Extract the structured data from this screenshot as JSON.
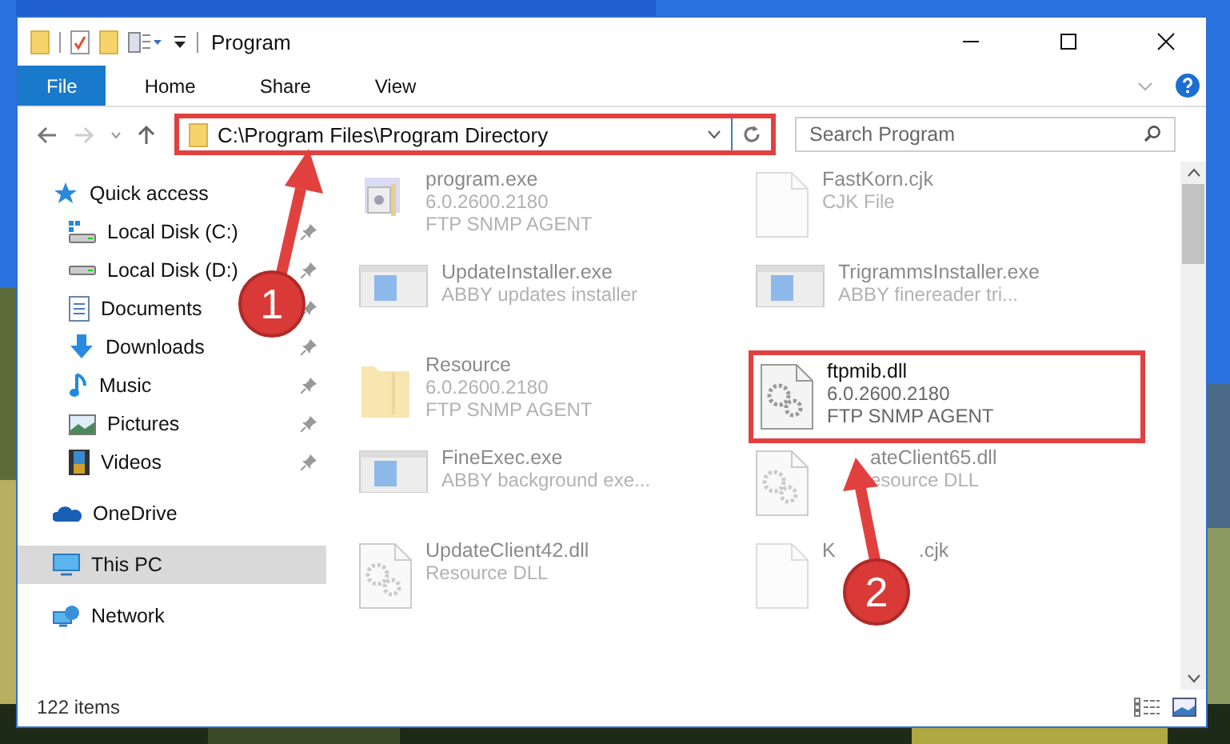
{
  "window": {
    "title": "Program"
  },
  "ribbon_tabs": [
    {
      "label": "File",
      "selected": true
    },
    {
      "label": "Home",
      "selected": false
    },
    {
      "label": "Share",
      "selected": false
    },
    {
      "label": "View",
      "selected": false
    }
  ],
  "address": {
    "path": "C:\\Program Files\\Program Directory",
    "highlighted": true
  },
  "search": {
    "placeholder": "Search Program"
  },
  "nav": [
    {
      "label": "Quick access",
      "kind": "star",
      "selected": false,
      "children": [
        {
          "label": "Local Disk (C:)",
          "kind": "disk-c",
          "pinned": true
        },
        {
          "label": "Local Disk (D:)",
          "kind": "disk",
          "pinned": true
        },
        {
          "label": "Documents",
          "kind": "docs",
          "pinned": true
        },
        {
          "label": "Downloads",
          "kind": "download",
          "pinned": true
        },
        {
          "label": "Music",
          "kind": "music",
          "pinned": true
        },
        {
          "label": "Pictures",
          "kind": "pictures",
          "pinned": true
        },
        {
          "label": "Videos",
          "kind": "videos",
          "pinned": true
        }
      ]
    },
    {
      "label": "OneDrive",
      "kind": "cloud",
      "selected": false
    },
    {
      "label": "This PC",
      "kind": "pc",
      "selected": true
    },
    {
      "label": "Network",
      "kind": "network",
      "selected": false
    }
  ],
  "files": [
    {
      "name": "program.exe",
      "details": [
        "6.0.2600.2180",
        "FTP SNMP AGENT"
      ],
      "kind": "app",
      "highlighted": false,
      "blurred": true
    },
    {
      "name": "FastKorn.cjk",
      "details": [
        "CJK File"
      ],
      "kind": "blank",
      "highlighted": false,
      "blurred": true
    },
    {
      "name": "UpdateInstaller.exe",
      "details": [
        "ABBY updates installer"
      ],
      "kind": "window",
      "highlighted": false,
      "blurred": true
    },
    {
      "name": "TrigrammsInstaller.exe",
      "details": [
        "ABBY finereader tri..."
      ],
      "kind": "window",
      "highlighted": false,
      "blurred": true
    },
    {
      "name": "Resource",
      "details": [
        "6.0.2600.2180",
        "FTP SNMP AGENT"
      ],
      "kind": "folder",
      "highlighted": false,
      "blurred": true
    },
    {
      "name": "ftpmib.dll",
      "details": [
        "6.0.2600.2180",
        "FTP SNMP AGENT"
      ],
      "kind": "gears",
      "highlighted": true,
      "blurred": false
    },
    {
      "name": "FineExec.exe",
      "details": [
        "ABBY background exe..."
      ],
      "kind": "window",
      "highlighted": false,
      "blurred": true
    },
    {
      "name": "ateClient65.dll",
      "details": [
        "esource DLL"
      ],
      "kind": "dll",
      "highlighted": false,
      "blurred": true,
      "covered": true
    },
    {
      "name": "UpdateClient42.dll",
      "details": [
        "Resource DLL"
      ],
      "kind": "dll",
      "highlighted": false,
      "blurred": true
    },
    {
      "name": "K",
      "name_tail": ".cjk",
      "kind": "blank",
      "highlighted": false,
      "blurred": true
    }
  ],
  "status": {
    "count": "122 items"
  },
  "annotations": [
    {
      "number": "1"
    },
    {
      "number": "2"
    }
  ]
}
